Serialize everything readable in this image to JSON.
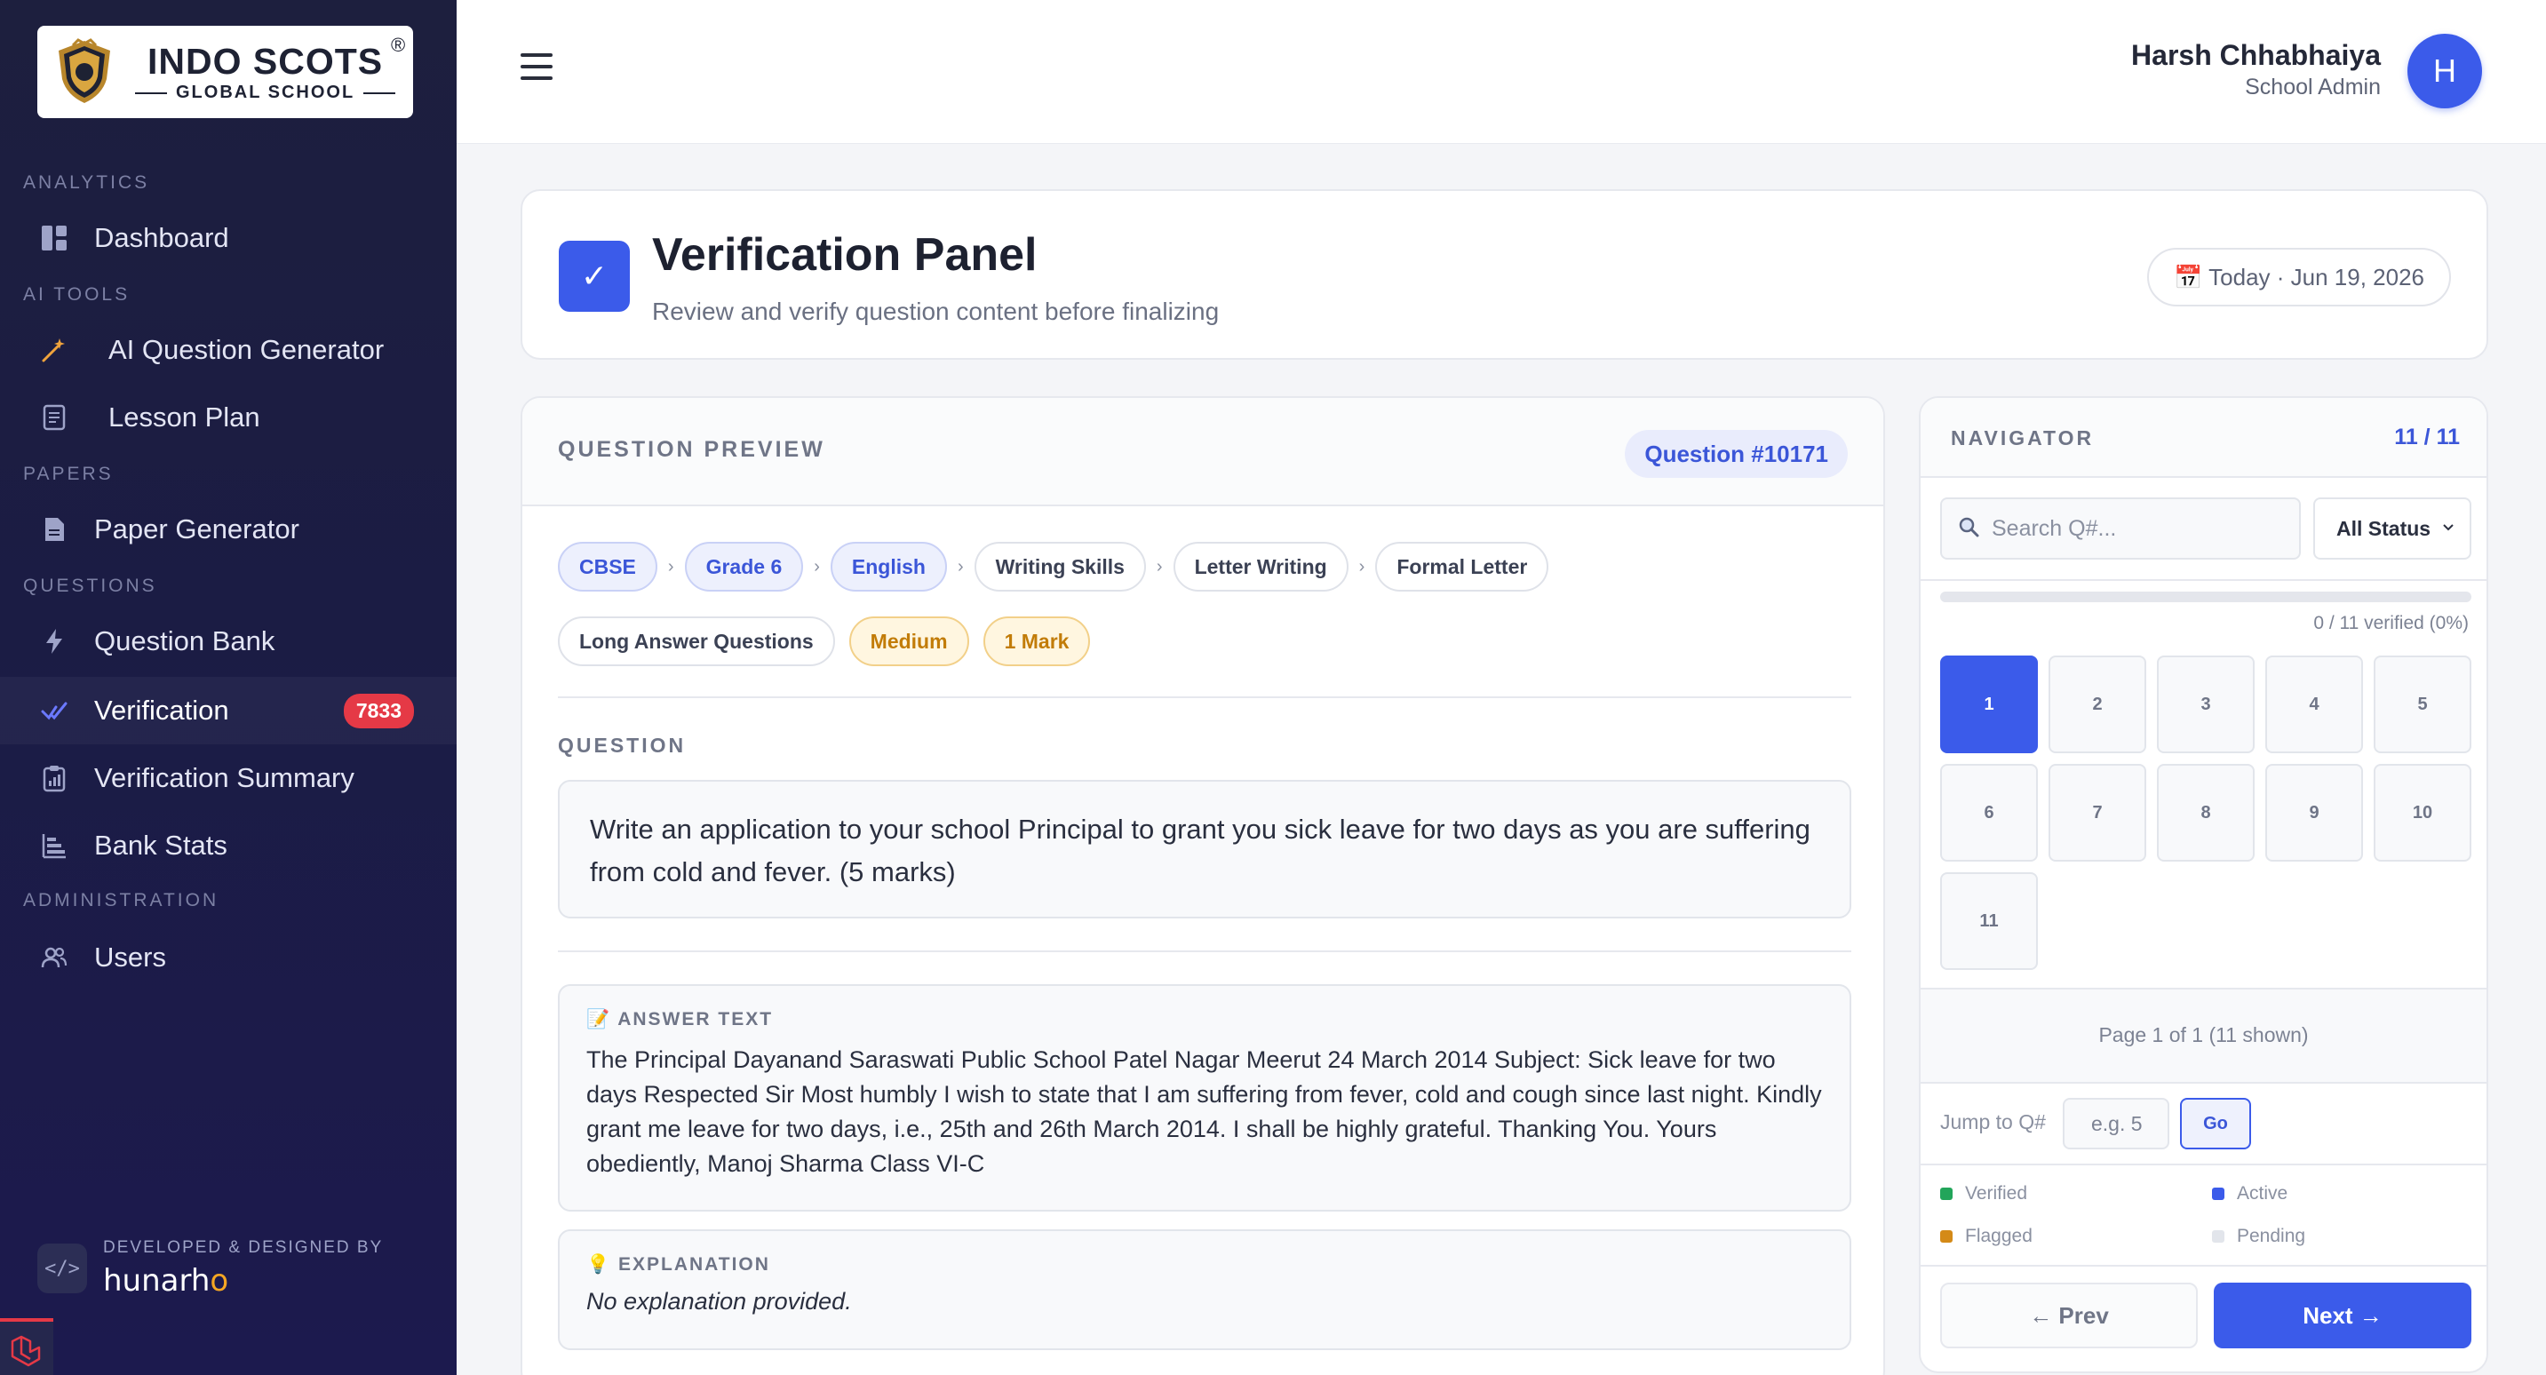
{
  "brand": {
    "name": "INDO SCOTS",
    "reg": "®",
    "sub": "GLOBAL SCHOOL"
  },
  "sidebar": {
    "sections": {
      "analytics": "ANALYTICS",
      "ai_tools": "AI TOOLS",
      "papers": "PAPERS",
      "questions": "QUESTIONS",
      "administration": "ADMINISTRATION"
    },
    "items": [
      {
        "label": "Dashboard",
        "icon": "dashboard-icon"
      },
      {
        "label": "AI Question Generator",
        "icon": "magic-wand-icon"
      },
      {
        "label": "Lesson Plan",
        "icon": "document-icon"
      },
      {
        "label": "Paper Generator",
        "icon": "file-icon"
      },
      {
        "label": "Question Bank",
        "icon": "bolt-icon"
      },
      {
        "label": "Verification",
        "icon": "check-icon",
        "badge": "7833"
      },
      {
        "label": "Verification Summary",
        "icon": "clipboard-icon"
      },
      {
        "label": "Bank Stats",
        "icon": "bars-icon"
      },
      {
        "label": "Users",
        "icon": "users-icon"
      }
    ],
    "footer": {
      "caption": "DEVELOPED & DESIGNED BY",
      "brand": "hunarh",
      "brand_accent": "o"
    }
  },
  "topbar": {
    "user_name": "Harsh Chhabhaiya",
    "user_role": "School Admin",
    "avatar_initial": "H"
  },
  "header": {
    "check": "✓",
    "title": "Verification Panel",
    "subtitle": "Review and verify question content before finalizing",
    "date": "📅 Today · Jun 19, 2026"
  },
  "preview": {
    "title": "QUESTION PREVIEW",
    "question_number": "Question #10171",
    "breadcrumb": [
      "CBSE",
      "Grade 6",
      "English",
      "Writing Skills",
      "Letter Writing",
      "Formal Letter"
    ],
    "tags": [
      "Long Answer Questions",
      "Medium",
      "1 Mark"
    ],
    "question_label": "QUESTION",
    "question_text": "Write an application to your school Principal to grant you sick leave for two days as you are suffering from cold and fever. (5 marks)",
    "answer_label": "📝 ANSWER TEXT",
    "answer_text": "The Principal Dayanand Saraswati Public School Patel Nagar Meerut 24 March 2014 Subject: Sick leave for two days Respected Sir Most humbly I wish to state that I am suffering from fever, cold and cough since last night. Kindly grant me leave for two days, i.e., 25th and 26th March 2014. I shall be highly grateful. Thanking You. Yours obediently, Manoj Sharma Class VI-C",
    "explanation_label": "💡 EXPLANATION",
    "explanation_text": "No explanation provided."
  },
  "navigator": {
    "title": "NAVIGATOR",
    "count": "11 / 11",
    "search_placeholder": "Search Q#...",
    "status_filter": "All Status",
    "verified_fraction": 0,
    "progress_text": "0 / 11 verified (0%)",
    "questions": [
      "1",
      "2",
      "3",
      "4",
      "5",
      "6",
      "7",
      "8",
      "9",
      "10",
      "11"
    ],
    "active_question": "1",
    "page_text": "Page 1 of 1 (11 shown)",
    "jump_label": "Jump to Q#",
    "jump_placeholder": "e.g. 5",
    "go_label": "Go",
    "legend": [
      {
        "label": "Verified",
        "color": "#22a55a"
      },
      {
        "label": "Active",
        "color": "#3b5bea"
      },
      {
        "label": "Flagged",
        "color": "#d48a17"
      },
      {
        "label": "Pending",
        "color": "#e2e5eb"
      }
    ],
    "prev_label": "← Prev",
    "next_label": "Next →"
  }
}
